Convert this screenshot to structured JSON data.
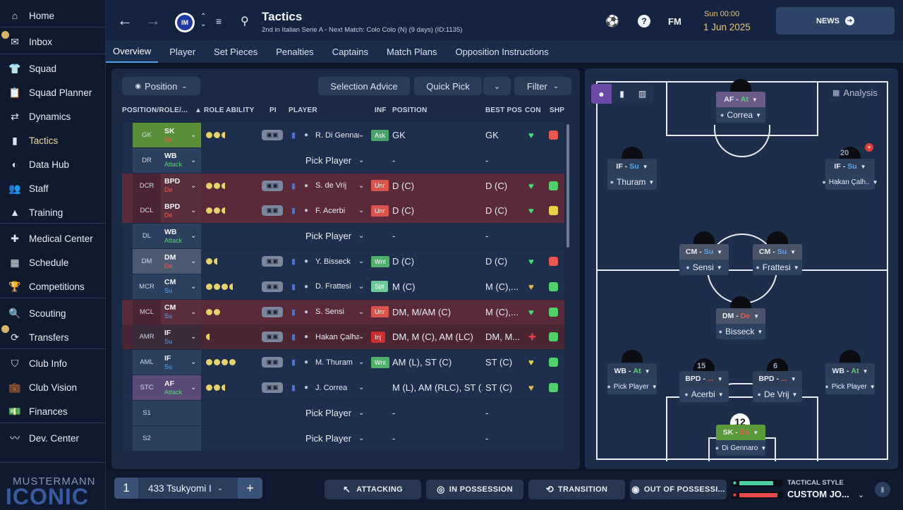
{
  "sidebar": {
    "items": [
      {
        "label": "Home",
        "icon": "home-icon",
        "glyph": "⌂"
      },
      {
        "label": "Inbox",
        "icon": "inbox-icon",
        "glyph": "✉"
      },
      {
        "label": "Squad",
        "icon": "shirt-icon",
        "glyph": "👕"
      },
      {
        "label": "Squad Planner",
        "icon": "clipboard-icon",
        "glyph": "📋"
      },
      {
        "label": "Dynamics",
        "icon": "dynamics-icon",
        "glyph": "⇄"
      },
      {
        "label": "Tactics",
        "icon": "tactics-icon",
        "glyph": "▮"
      },
      {
        "label": "Data Hub",
        "icon": "data-hub-icon",
        "glyph": "◐"
      },
      {
        "label": "Staff",
        "icon": "staff-icon",
        "glyph": "👥"
      },
      {
        "label": "Training",
        "icon": "training-icon",
        "glyph": "▲"
      },
      {
        "label": "Medical Center",
        "icon": "medical-icon",
        "glyph": "✚"
      },
      {
        "label": "Schedule",
        "icon": "calendar-icon",
        "glyph": "▦"
      },
      {
        "label": "Competitions",
        "icon": "trophy-icon",
        "glyph": "🏆"
      },
      {
        "label": "Scouting",
        "icon": "scouting-icon",
        "glyph": "🔍"
      },
      {
        "label": "Transfers",
        "icon": "transfers-icon",
        "glyph": "⟳"
      },
      {
        "label": "Club Info",
        "icon": "shield-icon",
        "glyph": "⛉"
      },
      {
        "label": "Club Vision",
        "icon": "briefcase-icon",
        "glyph": "💼"
      },
      {
        "label": "Finances",
        "icon": "finances-icon",
        "glyph": "💵"
      },
      {
        "label": "Dev. Center",
        "icon": "dev-center-icon",
        "glyph": "〰"
      }
    ],
    "logo_line1": "MUSTERMANN",
    "logo_line2": "ICONIC"
  },
  "header": {
    "title": "Tactics",
    "subtitle": "2nd in Italian Serie A - Next Match: Colo Colo (N) (9 days) (ID:1135)",
    "time": "Sun 00:00",
    "date": "1 Jun 2025",
    "fm_label": "FM",
    "news_label": "NEWS"
  },
  "subtabs": [
    "Overview",
    "Player",
    "Set Pieces",
    "Penalties",
    "Captains",
    "Match Plans",
    "Opposition Instructions"
  ],
  "toolbar": {
    "position_label": "Position",
    "selection_advice": "Selection Advice",
    "quick_pick": "Quick Pick",
    "filter": "Filter"
  },
  "columns": {
    "position_role": "POSITION/ROLE/...",
    "role_ability": "ROLE ABILITY",
    "pi": "PI",
    "player": "PLAYER",
    "inf": "INF",
    "position": "POSITION",
    "best_pos": "BEST POS",
    "con": "CON",
    "shp": "SHP"
  },
  "rows": [
    {
      "code": "GK",
      "role": "SK",
      "duty": "De",
      "duty_color": "#e8584e",
      "role_bg": "#5a8f3a",
      "dots": 2,
      "half": true,
      "player": "R. Di Gennaro",
      "inf": "Ask",
      "inf_color": "#4ca36a",
      "position": "GK",
      "best": "GK",
      "con": "♥",
      "con_color": "#3fe07a",
      "shp": "■",
      "shp_color": "#e8584e",
      "row_bg": "#1e2f4b",
      "code_bg": "#5a8f3a"
    },
    {
      "code": "DR",
      "role": "WB",
      "duty": "Attack",
      "duty_color": "#5fcf7a",
      "role_bg": "#2b3f5e",
      "dots": 0,
      "half": false,
      "player": "Pick Player",
      "inf": "",
      "inf_color": "",
      "position": "-",
      "best": "-",
      "con": "",
      "con_color": "",
      "shp": "",
      "shp_color": "",
      "row_bg": "#1e2f4b",
      "code_bg": "#2b3f5e",
      "pick": true
    },
    {
      "code": "DCR",
      "role": "BPD",
      "duty": "De",
      "duty_color": "#e8584e",
      "role_bg": "#5b2e3e",
      "dots": 2,
      "half": true,
      "player": "S. de Vrij",
      "inf": "Unr",
      "inf_color": "#d9544c",
      "position": "D (C)",
      "best": "D (C)",
      "con": "♥",
      "con_color": "#3fe07a",
      "shp": "■",
      "shp_color": "#4fd06a",
      "row_bg": "#5a2a3a",
      "code_bg": "#4a2434"
    },
    {
      "code": "DCL",
      "role": "BPD",
      "duty": "De",
      "duty_color": "#e8584e",
      "role_bg": "#5b2e3e",
      "dots": 2,
      "half": true,
      "player": "F. Acerbi",
      "inf": "Unr",
      "inf_color": "#d9544c",
      "position": "D (C)",
      "best": "D (C)",
      "con": "♥",
      "con_color": "#3fe07a",
      "shp": "■",
      "shp_color": "#e8d24a",
      "row_bg": "#5a2a3a",
      "code_bg": "#4a2434"
    },
    {
      "code": "DL",
      "role": "WB",
      "duty": "Attack",
      "duty_color": "#5fcf7a",
      "role_bg": "#2b3f5e",
      "dots": 0,
      "half": false,
      "player": "Pick Player",
      "inf": "",
      "inf_color": "",
      "position": "-",
      "best": "-",
      "con": "",
      "con_color": "",
      "shp": "",
      "shp_color": "",
      "row_bg": "#1e2f4b",
      "code_bg": "#2b3f5e",
      "pick": true
    },
    {
      "code": "DM",
      "role": "DM",
      "duty": "De",
      "duty_color": "#e8584e",
      "role_bg": "#4b5a70",
      "dots": 1,
      "half": true,
      "player": "Y. Bisseck",
      "inf": "Wnt",
      "inf_color": "#4fb06a",
      "position": "D (C)",
      "best": "D (C)",
      "con": "♥",
      "con_color": "#3fe07a",
      "shp": "■",
      "shp_color": "#e8584e",
      "row_bg": "#1e2f4b",
      "code_bg": "#4b5a70"
    },
    {
      "code": "MCR",
      "role": "CM",
      "duty": "Su",
      "duty_color": "#5aa6f0",
      "role_bg": "#2b3f5e",
      "dots": 3,
      "half": true,
      "player": "D. Frattesi",
      "inf": "Spt",
      "inf_color": "#6cc99a",
      "position": "M (C)",
      "best": "M (C),...",
      "con": "♥",
      "con_color": "#e8b84a",
      "shp": "■",
      "shp_color": "#4fd06a",
      "row_bg": "#1e2f4b",
      "code_bg": "#2b3f5e"
    },
    {
      "code": "MCL",
      "role": "CM",
      "duty": "Su",
      "duty_color": "#5aa6f0",
      "role_bg": "#5b2e3e",
      "dots": 2,
      "half": false,
      "player": "S. Sensi",
      "inf": "Unr",
      "inf_color": "#d9544c",
      "position": "DM, M/AM (C)",
      "best": "M (C),...",
      "con": "♥",
      "con_color": "#3fe07a",
      "shp": "■",
      "shp_color": "#4fd06a",
      "row_bg": "#5a2a3a",
      "code_bg": "#4a2434"
    },
    {
      "code": "AMR",
      "role": "IF",
      "duty": "Su",
      "duty_color": "#5aa6f0",
      "role_bg": "#3a2a3a",
      "dots": 0,
      "half": true,
      "player": "Hakan Çalhan..",
      "inf": "Inj",
      "inf_color": "#c83030",
      "position": "DM, M (C), AM (LC)",
      "best": "DM, M...",
      "con": "✚",
      "con_color": "#e84040",
      "shp": "■",
      "shp_color": "#4fd06a",
      "row_bg": "#4a2632",
      "code_bg": "#3a2a3a"
    },
    {
      "code": "AML",
      "role": "IF",
      "duty": "Su",
      "duty_color": "#5aa6f0",
      "role_bg": "#2b3f5e",
      "dots": 4,
      "half": false,
      "player": "M. Thuram",
      "inf": "Wnt",
      "inf_color": "#4fb06a",
      "position": "AM (L), ST (C)",
      "best": "ST (C)",
      "con": "♥",
      "con_color": "#e8d24a",
      "shp": "■",
      "shp_color": "#4fd06a",
      "row_bg": "#1e2f4b",
      "code_bg": "#2b3f5e"
    },
    {
      "code": "STC",
      "role": "AF",
      "duty": "Attack",
      "duty_color": "#5fcf7a",
      "role_bg": "#5a4a7a",
      "dots": 2,
      "half": true,
      "player": "J. Correa",
      "inf": "",
      "inf_color": "",
      "position": "M (L), AM (RLC), ST (...",
      "best": "ST (C)",
      "con": "♥",
      "con_color": "#e8b84a",
      "shp": "■",
      "shp_color": "#4fd06a",
      "row_bg": "#1e2f4b",
      "code_bg": "#5a4a7a"
    },
    {
      "code": "S1",
      "role": "",
      "duty": "",
      "duty_color": "",
      "role_bg": "#2b3f5e",
      "dots": 0,
      "half": false,
      "player": "Pick Player",
      "inf": "",
      "inf_color": "",
      "position": "-",
      "best": "-",
      "con": "",
      "con_color": "",
      "shp": "",
      "shp_color": "",
      "row_bg": "#1e2f4b",
      "code_bg": "#2b3f5e",
      "pick": true
    },
    {
      "code": "S2",
      "role": "",
      "duty": "",
      "duty_color": "",
      "role_bg": "#2b3f5e",
      "dots": 0,
      "half": false,
      "player": "Pick Player",
      "inf": "",
      "inf_color": "",
      "position": "-",
      "best": "-",
      "con": "",
      "con_color": "",
      "shp": "",
      "shp_color": "",
      "row_bg": "#1e2f4b",
      "code_bg": "#2b3f5e",
      "pick": true
    }
  ],
  "pitch": {
    "analysis_label": "Analysis",
    "cards": [
      {
        "role": "AF",
        "duty": "At",
        "duty_color": "#5fcf7a",
        "top_bg": "#6a5a8a",
        "name": "Correa"
      },
      {
        "role": "IF",
        "duty": "Su",
        "duty_color": "#5aa6f0",
        "top_bg": "#2c3e58",
        "name": "Thuram"
      },
      {
        "role": "IF",
        "duty": "Su",
        "duty_color": "#5aa6f0",
        "top_bg": "#2c3e58",
        "name": "Hakan Çalh.."
      },
      {
        "role": "CM",
        "duty": "Su",
        "duty_color": "#5aa6f0",
        "top_bg": "#4a5468",
        "name": "Sensi"
      },
      {
        "role": "CM",
        "duty": "Su",
        "duty_color": "#5aa6f0",
        "top_bg": "#4a5468",
        "name": "Frattesi"
      },
      {
        "role": "DM",
        "duty": "De",
        "duty_color": "#e8584e",
        "top_bg": "#4a5468",
        "name": "Bisseck"
      },
      {
        "role": "WB",
        "duty": "At",
        "duty_color": "#5fcf7a",
        "top_bg": "#2c3e58",
        "name": "Pick Player"
      },
      {
        "role": "BPD",
        "duty": "...",
        "duty_color": "#e8584e",
        "top_bg": "#2c3e58",
        "name": "Acerbi"
      },
      {
        "role": "BPD",
        "duty": "...",
        "duty_color": "#e8584e",
        "top_bg": "#2c3e58",
        "name": "De Vrij"
      },
      {
        "role": "WB",
        "duty": "At",
        "duty_color": "#5fcf7a",
        "top_bg": "#2c3e58",
        "name": "Pick Player"
      },
      {
        "role": "SK",
        "duty": "De",
        "duty_color": "#e8584e",
        "top_bg": "#5a9a3a",
        "name": "Di Gennaro"
      }
    ],
    "shirt_numbers": [
      "20",
      "15",
      "6",
      "12"
    ]
  },
  "bottom": {
    "slot": "1",
    "tactic_name": "433 Tsukyomi I",
    "attacking": "ATTACKING",
    "in_possession": "IN POSSESSION",
    "transition": "TRANSITION",
    "out_of_possession": "OUT OF POSSESSI...",
    "tactical_style_label": "TACTICAL STYLE",
    "tactical_style_value": "CUSTOM JO...",
    "familiarity": 0.8,
    "fitness": 0.9
  }
}
